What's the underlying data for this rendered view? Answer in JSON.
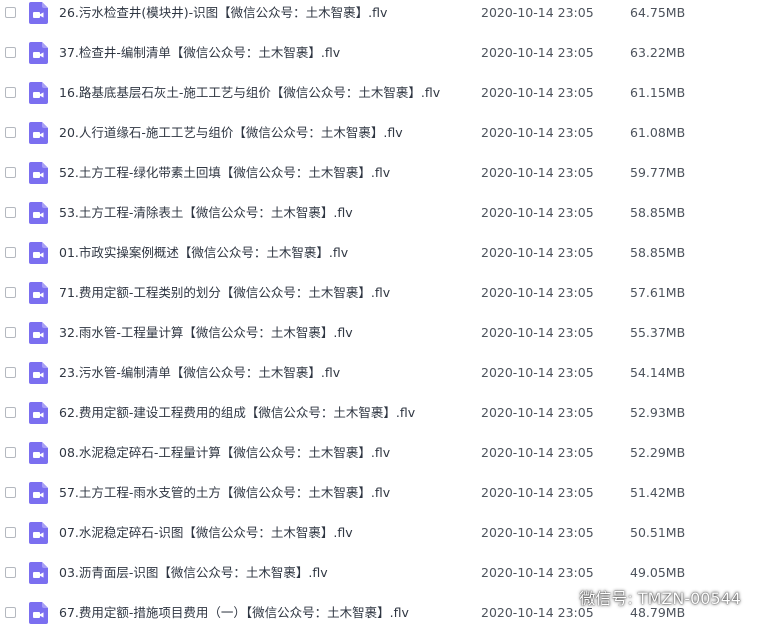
{
  "files": [
    {
      "name": "26.污水检查井(模块井)-识图【微信公众号：土木智裹】.flv",
      "date": "2020-10-14 23:05",
      "size": "64.75MB"
    },
    {
      "name": "37.检查井-编制清单【微信公众号：土木智裹】.flv",
      "date": "2020-10-14 23:05",
      "size": "63.22MB"
    },
    {
      "name": "16.路基底基层石灰土-施工工艺与组价【微信公众号：土木智裹】.flv",
      "date": "2020-10-14 23:05",
      "size": "61.15MB"
    },
    {
      "name": "20.人行道缘石-施工工艺与组价【微信公众号：土木智裹】.flv",
      "date": "2020-10-14 23:05",
      "size": "61.08MB"
    },
    {
      "name": "52.土方工程-绿化带素土回填【微信公众号：土木智裹】.flv",
      "date": "2020-10-14 23:05",
      "size": "59.77MB"
    },
    {
      "name": "53.土方工程-清除表土【微信公众号：土木智裹】.flv",
      "date": "2020-10-14 23:05",
      "size": "58.85MB"
    },
    {
      "name": "01.市政实操案例概述【微信公众号：土木智裹】.flv",
      "date": "2020-10-14 23:05",
      "size": "58.85MB"
    },
    {
      "name": "71.费用定额-工程类别的划分【微信公众号：土木智裹】.flv",
      "date": "2020-10-14 23:05",
      "size": "57.61MB"
    },
    {
      "name": "32.雨水管-工程量计算【微信公众号：土木智裹】.flv",
      "date": "2020-10-14 23:05",
      "size": "55.37MB"
    },
    {
      "name": "23.污水管-编制清单【微信公众号：土木智裹】.flv",
      "date": "2020-10-14 23:05",
      "size": "54.14MB"
    },
    {
      "name": "62.费用定额-建设工程费用的组成【微信公众号：土木智裹】.flv",
      "date": "2020-10-14 23:05",
      "size": "52.93MB"
    },
    {
      "name": "08.水泥稳定碎石-工程量计算【微信公众号：土木智裹】.flv",
      "date": "2020-10-14 23:05",
      "size": "52.29MB"
    },
    {
      "name": "57.土方工程-雨水支管的土方【微信公众号：土木智裹】.flv",
      "date": "2020-10-14 23:05",
      "size": "51.42MB"
    },
    {
      "name": "07.水泥稳定碎石-识图【微信公众号：土木智裹】.flv",
      "date": "2020-10-14 23:05",
      "size": "50.51MB"
    },
    {
      "name": "03.沥青面层-识图【微信公众号：土木智裹】.flv",
      "date": "2020-10-14 23:05",
      "size": "49.05MB"
    },
    {
      "name": "67.费用定额-措施项目费用（一）【微信公众号：土木智裹】.flv",
      "date": "2020-10-14 23:05",
      "size": "48.79MB"
    }
  ],
  "watermark": {
    "text": "微信号: TMZN-00544",
    "icon": "wechat-icon"
  },
  "colors": {
    "video_icon": "#7b6ff0",
    "text": "#2f3642"
  }
}
